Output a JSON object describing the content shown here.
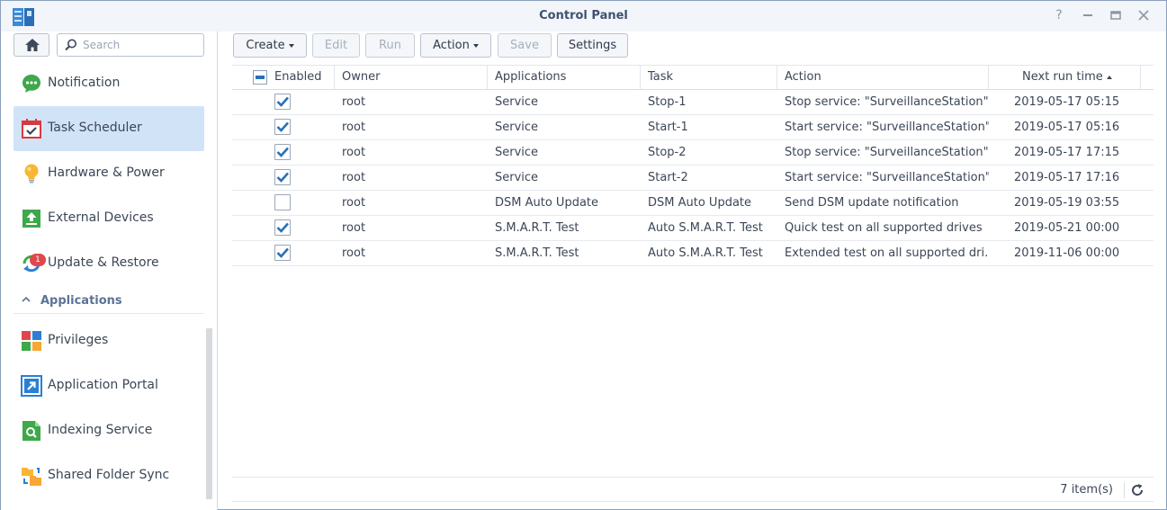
{
  "window": {
    "title": "Control Panel",
    "controls": [
      "help-icon",
      "minimize-icon",
      "maximize-icon",
      "close-icon"
    ]
  },
  "sidebar": {
    "search_placeholder": "Search",
    "items": [
      {
        "label": "Notification",
        "icon": "notification-icon",
        "active": false
      },
      {
        "label": "Task Scheduler",
        "icon": "task-scheduler-icon",
        "active": true
      },
      {
        "label": "Hardware & Power",
        "icon": "lightbulb-icon",
        "active": false
      },
      {
        "label": "External Devices",
        "icon": "external-devices-icon",
        "active": false
      },
      {
        "label": "Update & Restore",
        "icon": "update-restore-icon",
        "active": false,
        "badge": "1"
      }
    ],
    "section": "Applications",
    "app_items": [
      {
        "label": "Privileges",
        "icon": "privileges-icon"
      },
      {
        "label": "Application Portal",
        "icon": "application-portal-icon"
      },
      {
        "label": "Indexing Service",
        "icon": "indexing-service-icon"
      },
      {
        "label": "Shared Folder Sync",
        "icon": "shared-folder-sync-icon"
      }
    ]
  },
  "toolbar": {
    "create": "Create",
    "edit": "Edit",
    "run": "Run",
    "action": "Action",
    "save": "Save",
    "settings": "Settings"
  },
  "table": {
    "columns": [
      "Enabled",
      "Owner",
      "Applications",
      "Task",
      "Action",
      "Next run time"
    ],
    "sort_column": "Next run time",
    "rows": [
      {
        "enabled": true,
        "owner": "root",
        "application": "Service",
        "task": "Stop-1",
        "action": "Stop service: \"SurveillanceStation\"",
        "next_run": "2019-05-17 05:15"
      },
      {
        "enabled": true,
        "owner": "root",
        "application": "Service",
        "task": "Start-1",
        "action": "Start service: \"SurveillanceStation\"",
        "next_run": "2019-05-17 05:16"
      },
      {
        "enabled": true,
        "owner": "root",
        "application": "Service",
        "task": "Stop-2",
        "action": "Stop service: \"SurveillanceStation\"",
        "next_run": "2019-05-17 17:15"
      },
      {
        "enabled": true,
        "owner": "root",
        "application": "Service",
        "task": "Start-2",
        "action": "Start service: \"SurveillanceStation\"",
        "next_run": "2019-05-17 17:16"
      },
      {
        "enabled": false,
        "owner": "root",
        "application": "DSM Auto Update",
        "task": "DSM Auto Update",
        "action": "Send DSM update notification",
        "next_run": "2019-05-19 03:55"
      },
      {
        "enabled": true,
        "owner": "root",
        "application": "S.M.A.R.T. Test",
        "task": "Auto S.M.A.R.T. Test",
        "action": "Quick test on all supported drives",
        "next_run": "2019-05-21 00:00"
      },
      {
        "enabled": true,
        "owner": "root",
        "application": "S.M.A.R.T. Test",
        "task": "Auto S.M.A.R.T. Test",
        "action": "Extended test on all supported dri...",
        "next_run": "2019-11-06 00:00"
      }
    ]
  },
  "footer": {
    "count": "7 item(s)"
  },
  "colors": {
    "accent": "#2a6fb5",
    "active_bg": "#d1e3f7",
    "badge": "#e0474c"
  }
}
